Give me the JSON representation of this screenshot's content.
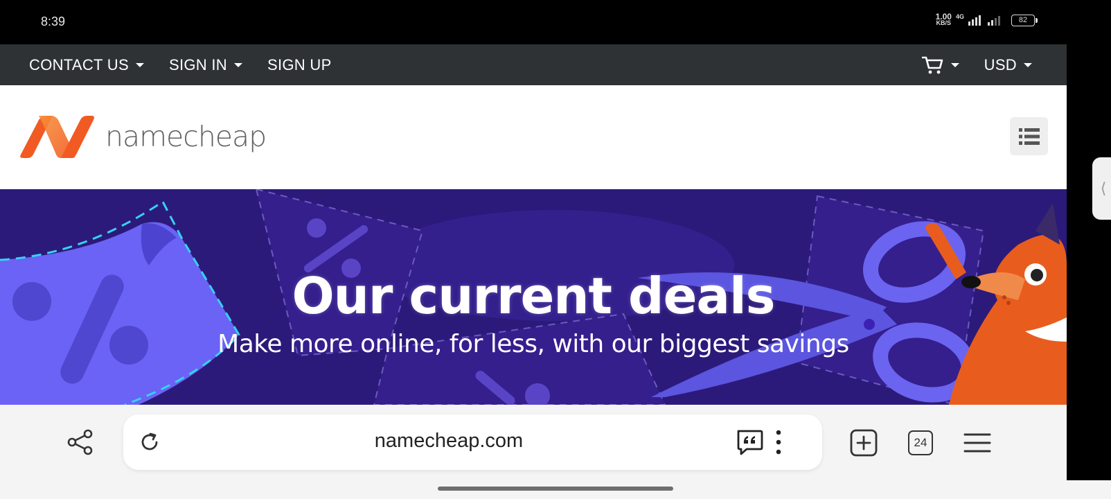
{
  "status_bar": {
    "time": "8:39",
    "net_speed_value": "1.00",
    "net_speed_unit": "KB/S",
    "network_type": "4G",
    "battery": "82"
  },
  "topnav": {
    "contact_label": "CONTACT US",
    "signin_label": "SIGN IN",
    "signup_label": "SIGN UP",
    "currency_label": "USD"
  },
  "brand": {
    "logo_text": "namecheap"
  },
  "hero": {
    "title": "Our current deals",
    "subtitle": "Make more online, for less, with our biggest savings"
  },
  "browser": {
    "url": "namecheap.com",
    "tab_count": "24"
  },
  "colors": {
    "nav_bg": "#2e3234",
    "hero_bg": "#2c1a7a",
    "brand_orange": "#f15a22",
    "accent_purple": "#6c63ff"
  },
  "side_handle": {
    "glyph": "⟨"
  }
}
